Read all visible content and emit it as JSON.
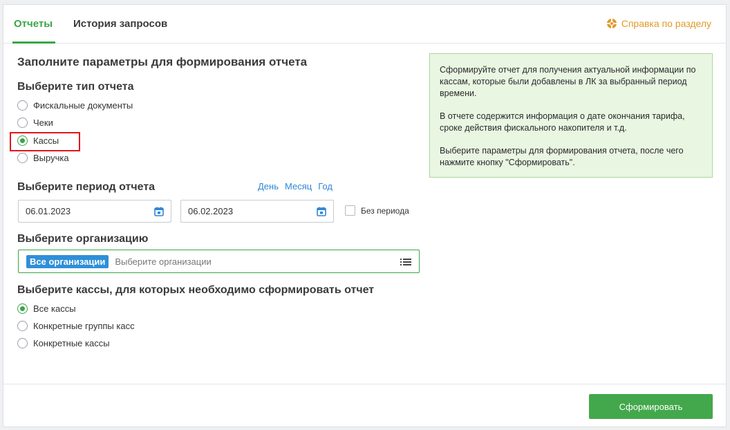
{
  "tabs": [
    {
      "label": "Отчеты",
      "active": true
    },
    {
      "label": "История запросов",
      "active": false
    }
  ],
  "help_link": "Справка по разделу",
  "form": {
    "title": "Заполните параметры для формирования отчета",
    "report_type": {
      "heading": "Выберите тип отчета",
      "options": [
        {
          "label": "Фискальные документы",
          "checked": false
        },
        {
          "label": "Чеки",
          "checked": false
        },
        {
          "label": "Кассы",
          "checked": true
        },
        {
          "label": "Выручка",
          "checked": false
        }
      ]
    },
    "period": {
      "heading": "Выберите период отчета",
      "quick_links": [
        "День",
        "Месяц",
        "Год"
      ],
      "date_from": "06.01.2023",
      "date_to": "06.02.2023",
      "no_period_label": "Без периода",
      "no_period_checked": false
    },
    "organization": {
      "heading": "Выберите организацию",
      "chip": "Все организации",
      "placeholder": "Выберите организации"
    },
    "cash_registers": {
      "heading": "Выберите кассы, для которых необходимо сформировать отчет",
      "options": [
        {
          "label": "Все кассы",
          "checked": true
        },
        {
          "label": "Конкретные группы касс",
          "checked": false
        },
        {
          "label": "Конкретные кассы",
          "checked": false
        }
      ]
    }
  },
  "info": {
    "paragraphs": [
      "Сформируйте отчет для получения актуальной информации по кассам, которые были добавлены в ЛК за выбранный период времени.",
      "В отчете содержится информация о дате окончания тарифа, сроке действия фискального накопителя и т.д.",
      "Выберите параметры для формирования отчета, после чего нажмите кнопку \"Сформировать\"."
    ]
  },
  "submit_label": "Сформировать",
  "colors": {
    "accent_green": "#3aa547",
    "link_blue": "#2f86d6",
    "help_orange": "#e09a2a",
    "highlight_red": "#e0161b"
  }
}
